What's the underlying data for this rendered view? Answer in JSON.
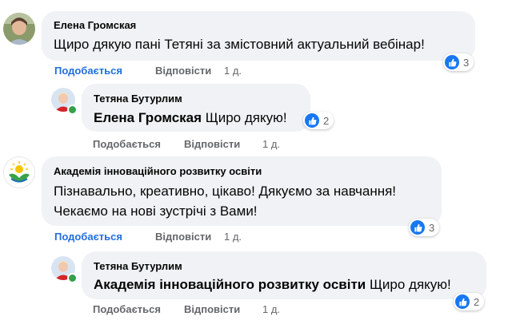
{
  "comments": [
    {
      "author": "Елена Громская",
      "text": "Щиро дякую пані Тетяні за змістовний актуальний вебінар!",
      "like_label": "Подобається",
      "reply_label": "Відповісти",
      "time": "1 д.",
      "reaction_count": "3"
    },
    {
      "author": "Тетяна Бутурлим",
      "mention": "Елена Громская",
      "text": "Щиро дякую!",
      "like_label": "Подобається",
      "reply_label": "Відповісти",
      "time": "1 д.",
      "reaction_count": "2"
    },
    {
      "author": "Академія інноваційного розвитку освіти",
      "text_line1": "Пізнавально, креативно, цікаво! Дякуємо за навчання!",
      "text_line2": "Чекаємо на нові зустрічі з Вами!",
      "like_label": "Подобається",
      "reply_label": "Відповісти",
      "time": "1 д.",
      "reaction_count": "3"
    },
    {
      "author": "Тетяна Бутурлим",
      "mention": "Академія інноваційного розвитку освіти",
      "text": "Щиро дякую!",
      "like_label": "Подобається",
      "reply_label": "Відповісти",
      "time": "1 д.",
      "reaction_count": "2"
    }
  ],
  "colors": {
    "bubble": "#f0f2f5",
    "like_blue": "#1877f2",
    "secondary_text": "#65676b",
    "online_green": "#31a24c"
  }
}
